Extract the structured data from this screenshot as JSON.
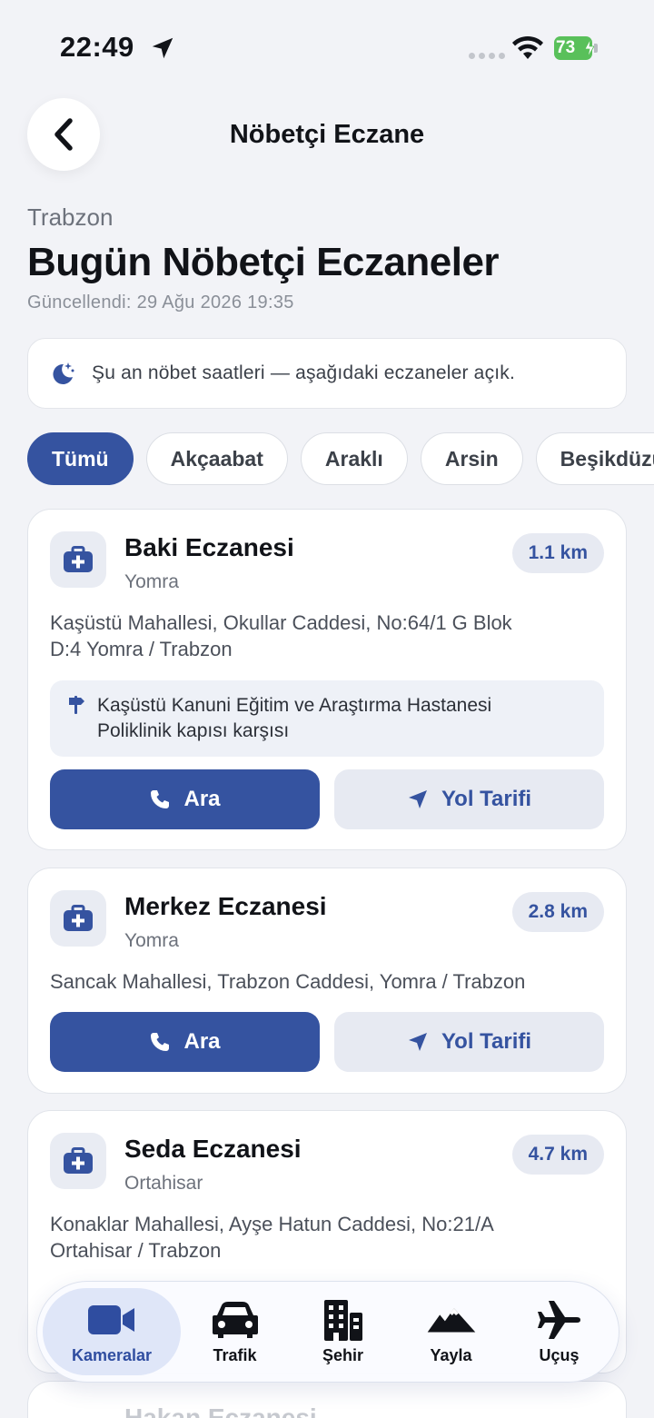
{
  "status_bar": {
    "time": "22:49",
    "battery": "73"
  },
  "header": {
    "title": "Nöbetçi Eczane"
  },
  "city": "Trabzon",
  "page_title": "Bugün Nöbetçi Eczaneler",
  "updated": "Güncellendi: 29 Ağu 2026 19:35",
  "info_banner": "Şu an nöbet saatleri — aşağıdaki eczaneler açık.",
  "chips": [
    "Tümü",
    "Akçaabat",
    "Araklı",
    "Arsin",
    "Beşikdüzü"
  ],
  "pharmacies": [
    {
      "name": "Baki Eczanesi",
      "district": "Yomra",
      "distance": "1.1 km",
      "address_line1": "Kaşüstü Mahallesi, Okullar Caddesi, No:64/1 G Blok",
      "address_line2": "D:4 Yomra / Trabzon",
      "note_line1": "Kaşüstü Kanuni Eğitim ve Araştırma Hastanesi",
      "note_line2": "Poliklinik kapısı karşısı",
      "call_label": "Ara",
      "directions_label": "Yol Tarifi"
    },
    {
      "name": "Merkez Eczanesi",
      "district": "Yomra",
      "distance": "2.8 km",
      "address_line1": "Sancak Mahallesi, Trabzon Caddesi, Yomra / Trabzon",
      "call_label": "Ara",
      "directions_label": "Yol Tarifi"
    },
    {
      "name": "Seda Eczanesi",
      "district": "Ortahisar",
      "distance": "4.7 km",
      "address_line1": "Konaklar Mahallesi, Ayşe Hatun Caddesi, No:21/A",
      "address_line2": "Ortahisar / Trabzon"
    },
    {
      "name": "Hakan Eczanesi"
    }
  ],
  "tabbar": {
    "items": [
      {
        "label": "Kameralar",
        "icon": "video-camera-icon",
        "active": true
      },
      {
        "label": "Trafik",
        "icon": "car-icon"
      },
      {
        "label": "Şehir",
        "icon": "building-icon"
      },
      {
        "label": "Yayla",
        "icon": "mountain-icon"
      },
      {
        "label": "Uçuş",
        "icon": "airplane-icon"
      }
    ]
  },
  "colors": {
    "accent": "#3553a0",
    "background": "#f2f3f7",
    "battery": "#59c05a"
  }
}
